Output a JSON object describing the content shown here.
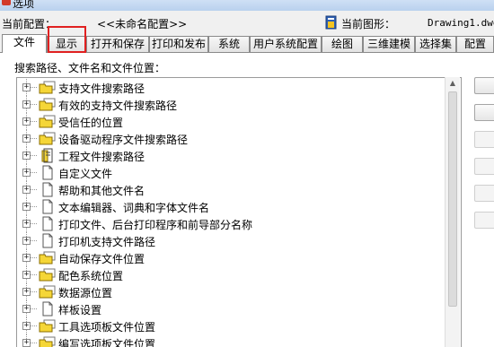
{
  "window": {
    "title": "选项"
  },
  "profile": {
    "label": "当前配置：",
    "value": "<<未命名配置>>",
    "drawing_label": "当前图形：",
    "drawing_value": "Drawing1.dwg"
  },
  "tabs": [
    {
      "label": "文件"
    },
    {
      "label": "显示"
    },
    {
      "label": "打开和保存"
    },
    {
      "label": "打印和发布"
    },
    {
      "label": "系统"
    },
    {
      "label": "用户系统配置"
    },
    {
      "label": "绘图"
    },
    {
      "label": "三维建模"
    },
    {
      "label": "选择集"
    },
    {
      "label": "配置"
    }
  ],
  "active_tab": "文件",
  "annotation": {
    "highlighted_tab": "显示",
    "color": "#e02020"
  },
  "section_label": "搜索路径、文件名和文件位置：",
  "tree": {
    "items": [
      {
        "label": "支持文件搜索路径",
        "icon": "folder-stack-icon"
      },
      {
        "label": "有效的支持文件搜索路径",
        "icon": "folder-stack-icon"
      },
      {
        "label": "受信任的位置",
        "icon": "folder-stack-icon"
      },
      {
        "label": "设备驱动程序文件搜索路径",
        "icon": "folder-stack-icon"
      },
      {
        "label": "工程文件搜索路径",
        "icon": "project-file-icon"
      },
      {
        "label": "自定义文件",
        "icon": "document-icon"
      },
      {
        "label": "帮助和其他文件名",
        "icon": "document-icon"
      },
      {
        "label": "文本编辑器、词典和字体文件名",
        "icon": "document-icon"
      },
      {
        "label": "打印文件、后台打印程序和前导部分名称",
        "icon": "document-icon"
      },
      {
        "label": "打印机支持文件路径",
        "icon": "document-icon"
      },
      {
        "label": "自动保存文件位置",
        "icon": "folder-stack-icon"
      },
      {
        "label": "配色系统位置",
        "icon": "folder-stack-icon"
      },
      {
        "label": "数据源位置",
        "icon": "folder-stack-icon"
      },
      {
        "label": "样板设置",
        "icon": "document-icon"
      },
      {
        "label": "工具选项板文件位置",
        "icon": "folder-stack-icon"
      },
      {
        "label": "编写选项板文件位置",
        "icon": "folder-stack-icon"
      }
    ]
  },
  "colors": {
    "folder": "#f5d637",
    "folder_edge": "#8a6d00",
    "tab_highlight": "#e02020"
  }
}
